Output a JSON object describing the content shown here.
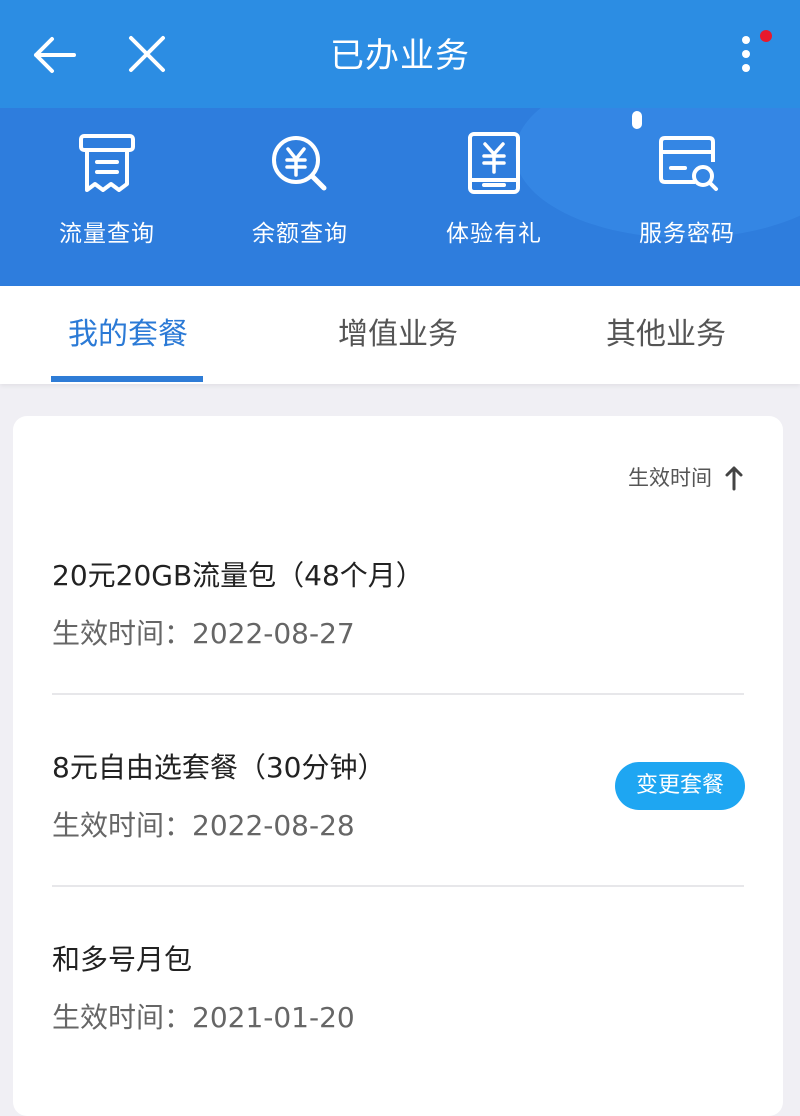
{
  "header": {
    "title": "已办业务",
    "back_icon": "back-arrow-icon",
    "close_icon": "close-icon",
    "more_icon": "more-vertical-icon",
    "notification_dot_color": "#e8192c"
  },
  "quick_actions": [
    {
      "label": "流量查询",
      "icon": "receipt-icon"
    },
    {
      "label": "余额查询",
      "icon": "yuan-search-icon"
    },
    {
      "label": "体验有礼",
      "icon": "yuan-phone-icon"
    },
    {
      "label": "服务密码",
      "icon": "card-search-icon"
    }
  ],
  "tabs": [
    {
      "label": "我的套餐",
      "active": true
    },
    {
      "label": "增值业务",
      "active": false
    },
    {
      "label": "其他业务",
      "active": false
    }
  ],
  "sort": {
    "label": "生效时间",
    "icon": "arrow-up-icon"
  },
  "packages": [
    {
      "name": "20元20GB流量包（48个月）",
      "date": "生效时间：2022-08-27"
    },
    {
      "name": "8元自由选套餐（30分钟）",
      "date": "生效时间：2022-08-28",
      "action": "变更套餐"
    },
    {
      "name": "和多号月包",
      "date": "生效时间：2021-01-20"
    }
  ],
  "colors": {
    "header_bg": "#2c8de3",
    "icon_bar_bg": "#2e7ddd",
    "active_tab": "#2b7ad6",
    "change_button": "#1ea6f2",
    "page_bg": "#f0eff4"
  }
}
